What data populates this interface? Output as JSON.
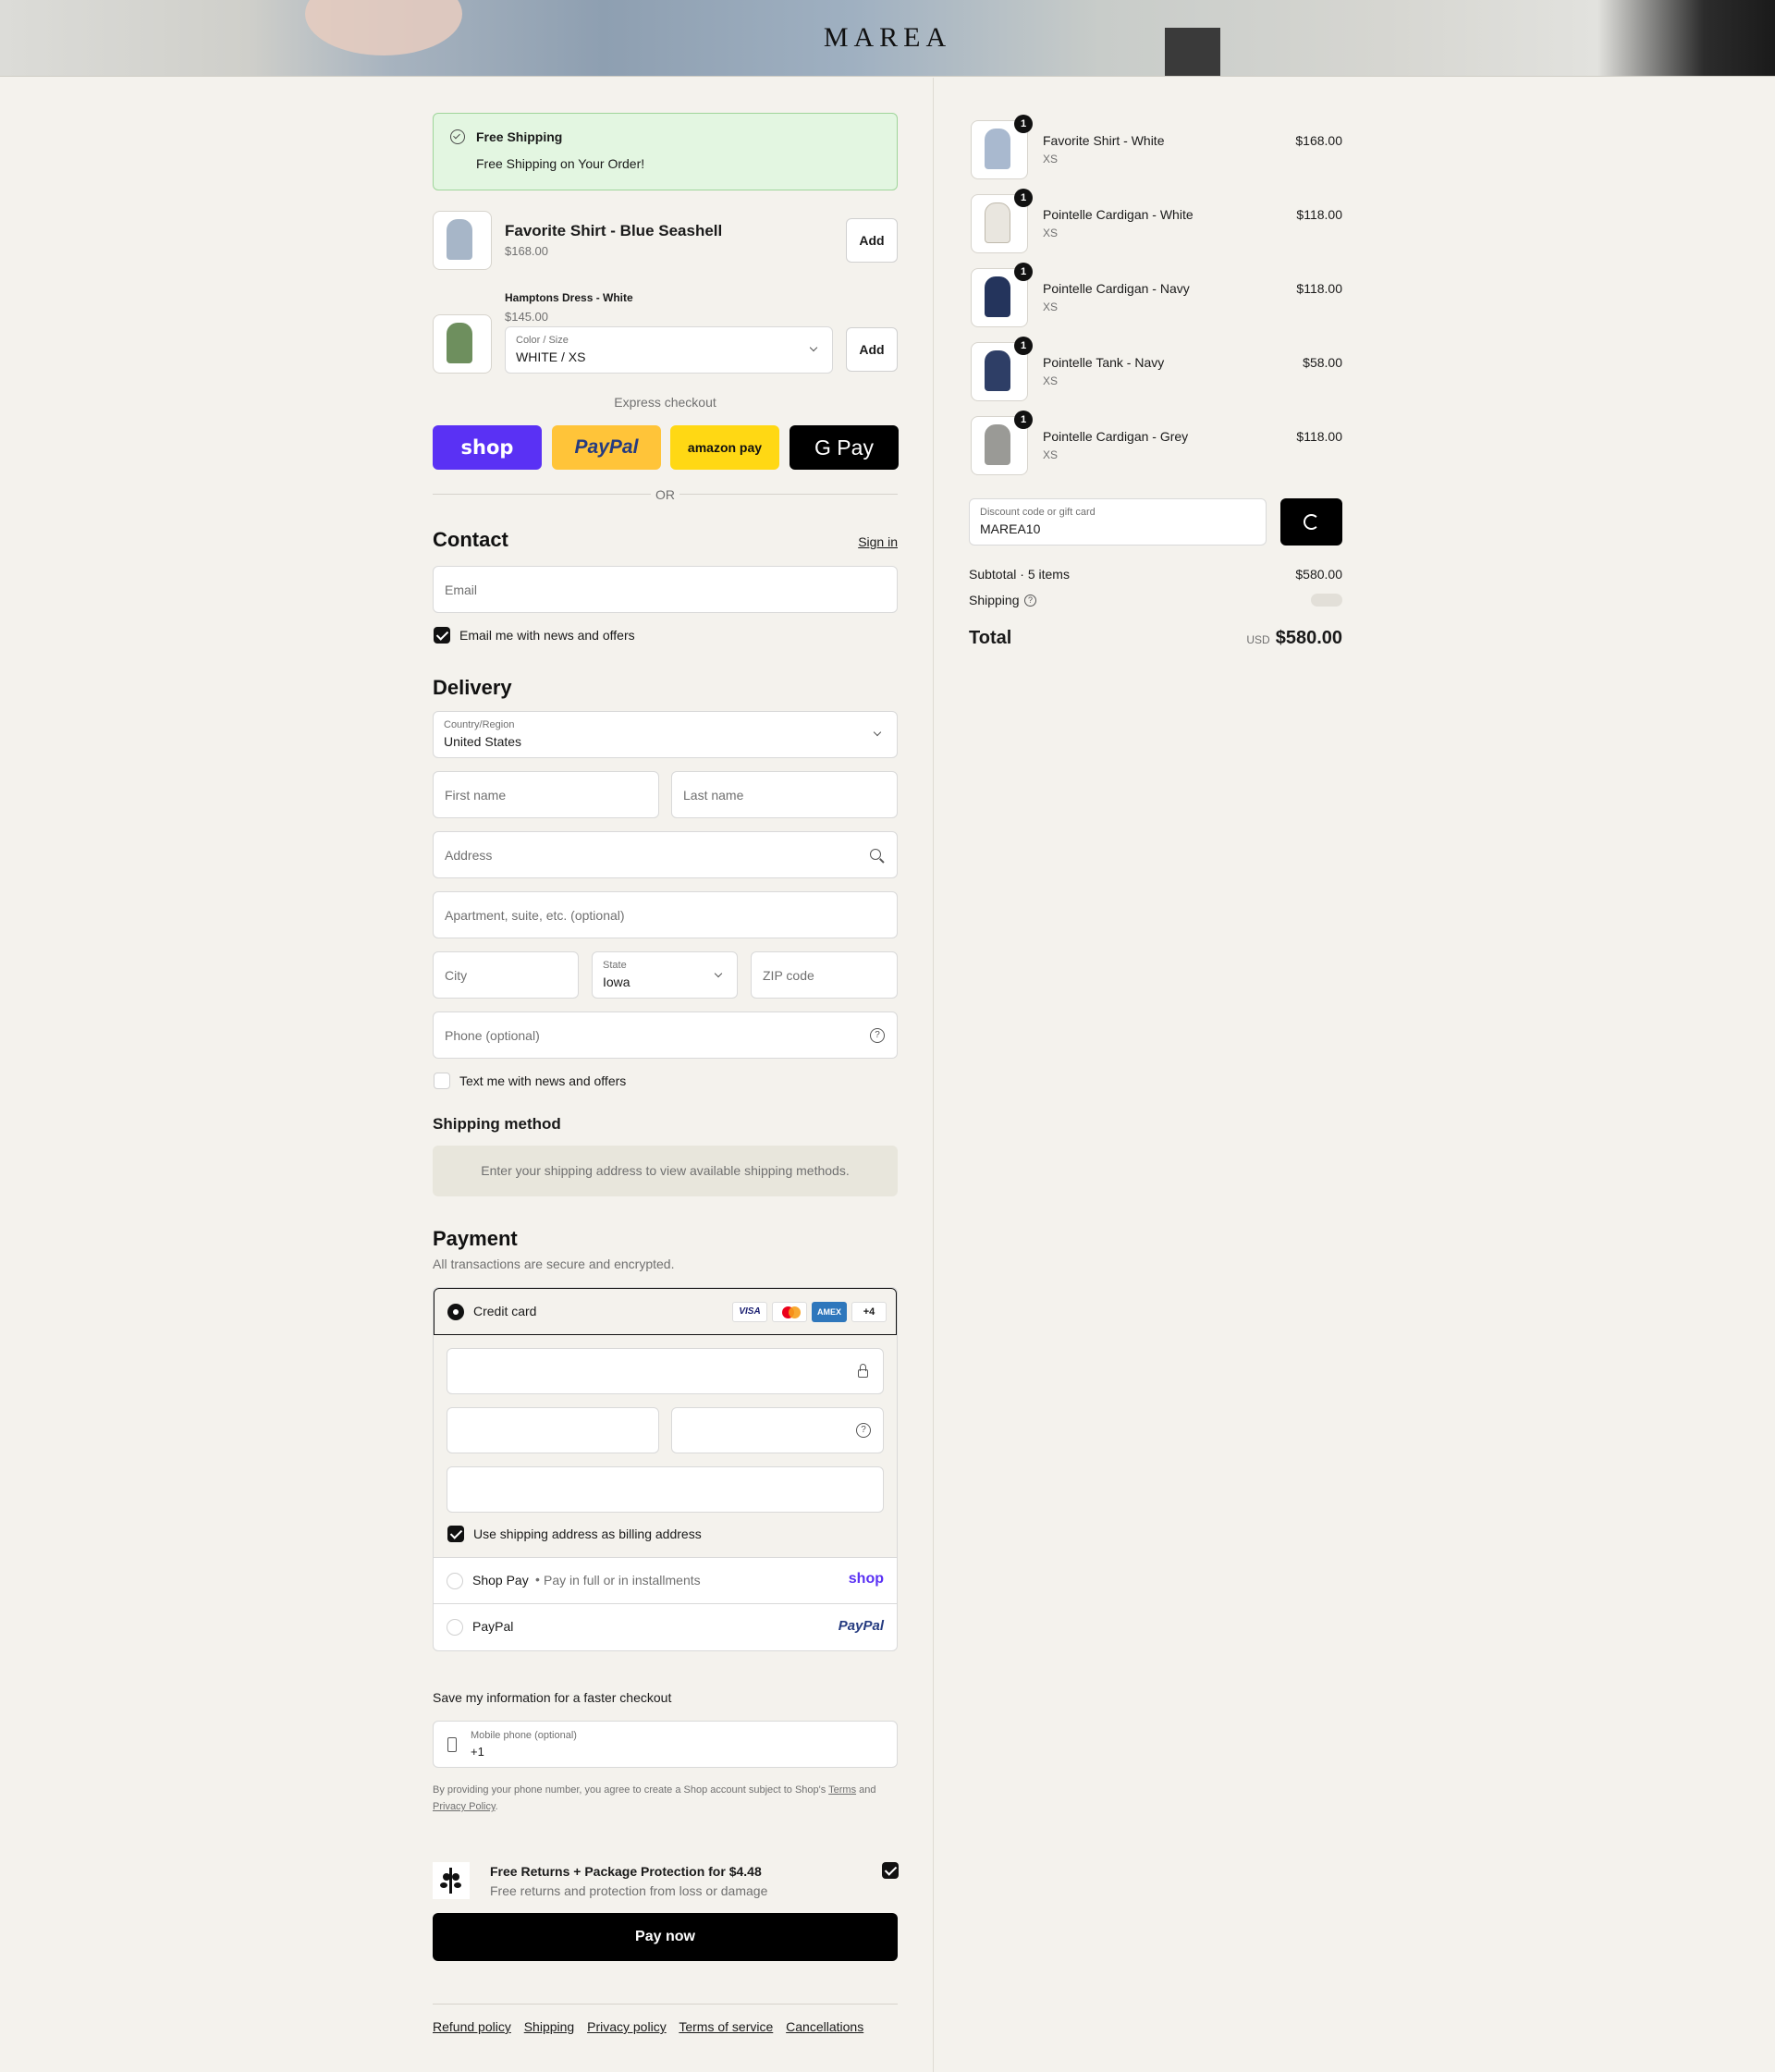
{
  "brand": {
    "name": "MAREA"
  },
  "banner": {
    "title": "Free Shipping",
    "text": "Free Shipping on Your Order!"
  },
  "upsells": [
    {
      "name": "Favorite Shirt - Blue Seashell",
      "price": "$168.00",
      "add": "Add"
    },
    {
      "name": "Hamptons Dress - White",
      "price": "$145.00",
      "variant_label": "Color / Size",
      "variant_value": "WHITE / XS",
      "add": "Add"
    }
  ],
  "express": {
    "label": "Express checkout",
    "buttons": [
      {
        "name": "shop",
        "color": "#5a31f4"
      },
      {
        "name": "PayPal",
        "color": "#ffc439"
      },
      {
        "name": "amazon pay",
        "color": "#ffd814"
      },
      {
        "name": "G Pay",
        "color": "#000000"
      }
    ],
    "or": "OR"
  },
  "contact": {
    "title": "Contact",
    "sign_in": "Sign in",
    "email_placeholder": "Email",
    "news_label": "Email me with news and offers"
  },
  "delivery": {
    "title": "Delivery",
    "country_label": "Country/Region",
    "country_value": "United States",
    "first_name": "First name",
    "last_name": "Last name",
    "address": "Address",
    "apartment": "Apartment, suite, etc. (optional)",
    "city": "City",
    "state_label": "State",
    "state_value": "Iowa",
    "zip": "ZIP code",
    "phone": "Phone (optional)",
    "text_label": "Text me with news and offers"
  },
  "shipping_method": {
    "title": "Shipping method",
    "message": "Enter your shipping address to view available shipping methods."
  },
  "payment": {
    "title": "Payment",
    "subtitle": "All transactions are secure and encrypted.",
    "credit_card": "Credit card",
    "cards": [
      "VISA",
      "Mastercard",
      "AMEX"
    ],
    "more_cards": "+4",
    "billing_label": "Use shipping address as billing address",
    "shop_pay": "Shop Pay",
    "shop_pay_sub": "Pay in full or in installments",
    "shop_logo": "shop",
    "paypal": "PayPal",
    "paypal_logo": "PayPal"
  },
  "save_info": {
    "title": "Save my information for a faster checkout",
    "phone_label": "Mobile phone (optional)",
    "phone_value": "+1",
    "disclaimer_1": "By providing your phone number, you agree to create a Shop account subject to Shop's",
    "terms": "Terms",
    "disclaimer_2": "and",
    "privacy": "Privacy Policy",
    "period": "."
  },
  "protection": {
    "title": "Free Returns + Package Protection for $4.48",
    "subtitle": "Free returns and protection from loss or damage"
  },
  "pay_now": "Pay now",
  "footer_links": [
    "Refund policy",
    "Shipping",
    "Privacy policy",
    "Terms of service",
    "Cancellations"
  ],
  "order": {
    "items": [
      {
        "name": "Favorite Shirt - White",
        "variant": "XS",
        "price": "$168.00",
        "qty": "1"
      },
      {
        "name": "Pointelle Cardigan - White",
        "variant": "XS",
        "price": "$118.00",
        "qty": "1"
      },
      {
        "name": "Pointelle Cardigan - Navy",
        "variant": "XS",
        "price": "$118.00",
        "qty": "1"
      },
      {
        "name": "Pointelle Tank - Navy",
        "variant": "XS",
        "price": "$58.00",
        "qty": "1"
      },
      {
        "name": "Pointelle Cardigan - Grey",
        "variant": "XS",
        "price": "$118.00",
        "qty": "1"
      }
    ],
    "discount_label": "Discount code or gift card",
    "discount_value": "MAREA10",
    "subtotal_label": "Subtotal · 5 items",
    "subtotal_value": "$580.00",
    "shipping_label": "Shipping",
    "total_label": "Total",
    "currency": "USD",
    "total_value": "$580.00"
  }
}
